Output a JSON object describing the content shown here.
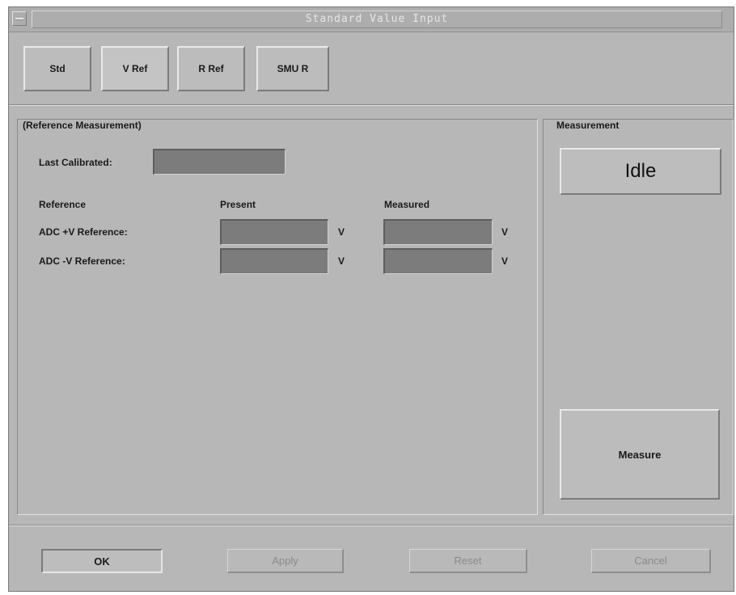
{
  "window": {
    "title": "Standard Value Input"
  },
  "tabs": [
    {
      "label": "Std",
      "active": false
    },
    {
      "label": "V Ref",
      "active": true
    },
    {
      "label": "R Ref",
      "active": false
    },
    {
      "label": "SMU R",
      "active": false
    }
  ],
  "reference_panel": {
    "title": "(Reference Measurement)",
    "last_calibrated_label": "Last Calibrated:",
    "last_calibrated_value": "",
    "columns": {
      "reference": "Reference",
      "present": "Present",
      "measured": "Measured"
    },
    "rows": [
      {
        "label": "ADC +V Reference:",
        "present": "",
        "present_unit": "V",
        "measured": "",
        "measured_unit": "V"
      },
      {
        "label": "ADC -V Reference:",
        "present": "",
        "present_unit": "V",
        "measured": "",
        "measured_unit": "V"
      }
    ]
  },
  "measurement_panel": {
    "title": "Measurement",
    "status": "Idle",
    "measure_button": "Measure"
  },
  "footer": {
    "ok": "OK",
    "apply": "Apply",
    "reset": "Reset",
    "cancel": "Cancel"
  }
}
